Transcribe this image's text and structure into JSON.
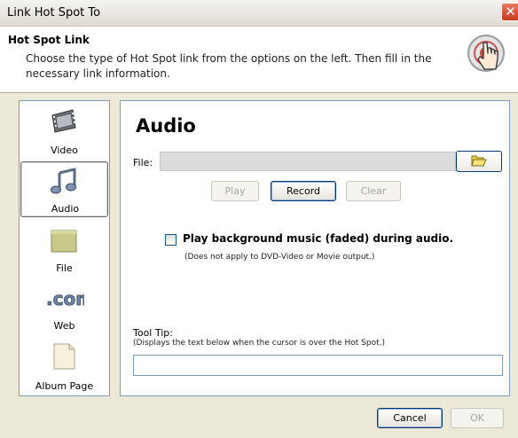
{
  "window": {
    "title": "Link Hot Spot To"
  },
  "header": {
    "title": "Hot Spot Link",
    "description": "Choose the type of Hot Spot link from the options on the left. Then fill in the necessary link information."
  },
  "sidebar": {
    "items": [
      {
        "label": "Video",
        "icon": "video-film-icon",
        "selected": false
      },
      {
        "label": "Audio",
        "icon": "music-note-icon",
        "selected": true
      },
      {
        "label": "File",
        "icon": "folder-icon",
        "selected": false
      },
      {
        "label": "Web",
        "icon": "dot-com-icon",
        "selected": false
      },
      {
        "label": "Album Page",
        "icon": "page-icon",
        "selected": false
      }
    ]
  },
  "panel": {
    "title": "Audio",
    "file_label": "File:",
    "file_value": "",
    "buttons": {
      "play": "Play",
      "record": "Record",
      "clear": "Clear"
    },
    "background_music": {
      "label": "Play background music (faded) during audio.",
      "checked": false,
      "note": "(Does not apply to DVD-Video or Movie output.)"
    },
    "tooltip": {
      "label": "Tool Tip:",
      "note": "(Displays the text below when the cursor is over the Hot Spot.)",
      "value": ""
    }
  },
  "footer": {
    "cancel": "Cancel",
    "ok": "OK"
  },
  "colors": {
    "accent": "#003c74",
    "title_bg": "#ece9d8",
    "close": "#c53d1f"
  }
}
